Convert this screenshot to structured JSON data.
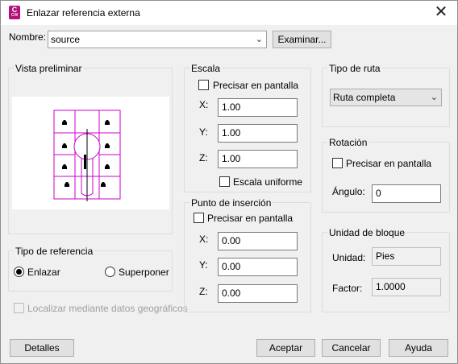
{
  "window": {
    "title": "Enlazar referencia externa",
    "close_glyph": "✕",
    "icon": {
      "letter": "C",
      "sub": "CW"
    }
  },
  "name_row": {
    "label": "Nombre:",
    "value": "source",
    "browse_label": "Examinar..."
  },
  "preview": {
    "title": "Vista preliminar"
  },
  "scale": {
    "title": "Escala",
    "specify_on_screen": "Precisar en pantalla",
    "x_label": "X:",
    "x_value": "1.00",
    "y_label": "Y:",
    "y_value": "1.00",
    "z_label": "Z:",
    "z_value": "1.00",
    "uniform_label": "Escala uniforme"
  },
  "insertion": {
    "title": "Punto de inserción",
    "specify_on_screen": "Precisar en pantalla",
    "x_label": "X:",
    "x_value": "0.00",
    "y_label": "Y:",
    "y_value": "0.00",
    "z_label": "Z:",
    "z_value": "0.00"
  },
  "path_type": {
    "title": "Tipo de ruta",
    "selected": "Ruta completa"
  },
  "rotation": {
    "title": "Rotación",
    "specify_on_screen": "Precisar en pantalla",
    "angle_label": "Ángulo:",
    "angle_value": "0"
  },
  "block_unit": {
    "title": "Unidad de bloque",
    "unit_label": "Unidad:",
    "unit_value": "Pies",
    "factor_label": "Factor:",
    "factor_value": "1.0000"
  },
  "ref_type": {
    "title": "Tipo de referencia",
    "attach_label": "Enlazar",
    "overlay_label": "Superponer",
    "selected": "attach"
  },
  "geo": {
    "label": "Localizar mediante datos geográficos"
  },
  "footer": {
    "details": "Detalles",
    "ok": "Aceptar",
    "cancel": "Cancelar",
    "help": "Ayuda"
  },
  "colors": {
    "preview_lines": "#cc00cc",
    "accent_icon": "#b4127a"
  }
}
